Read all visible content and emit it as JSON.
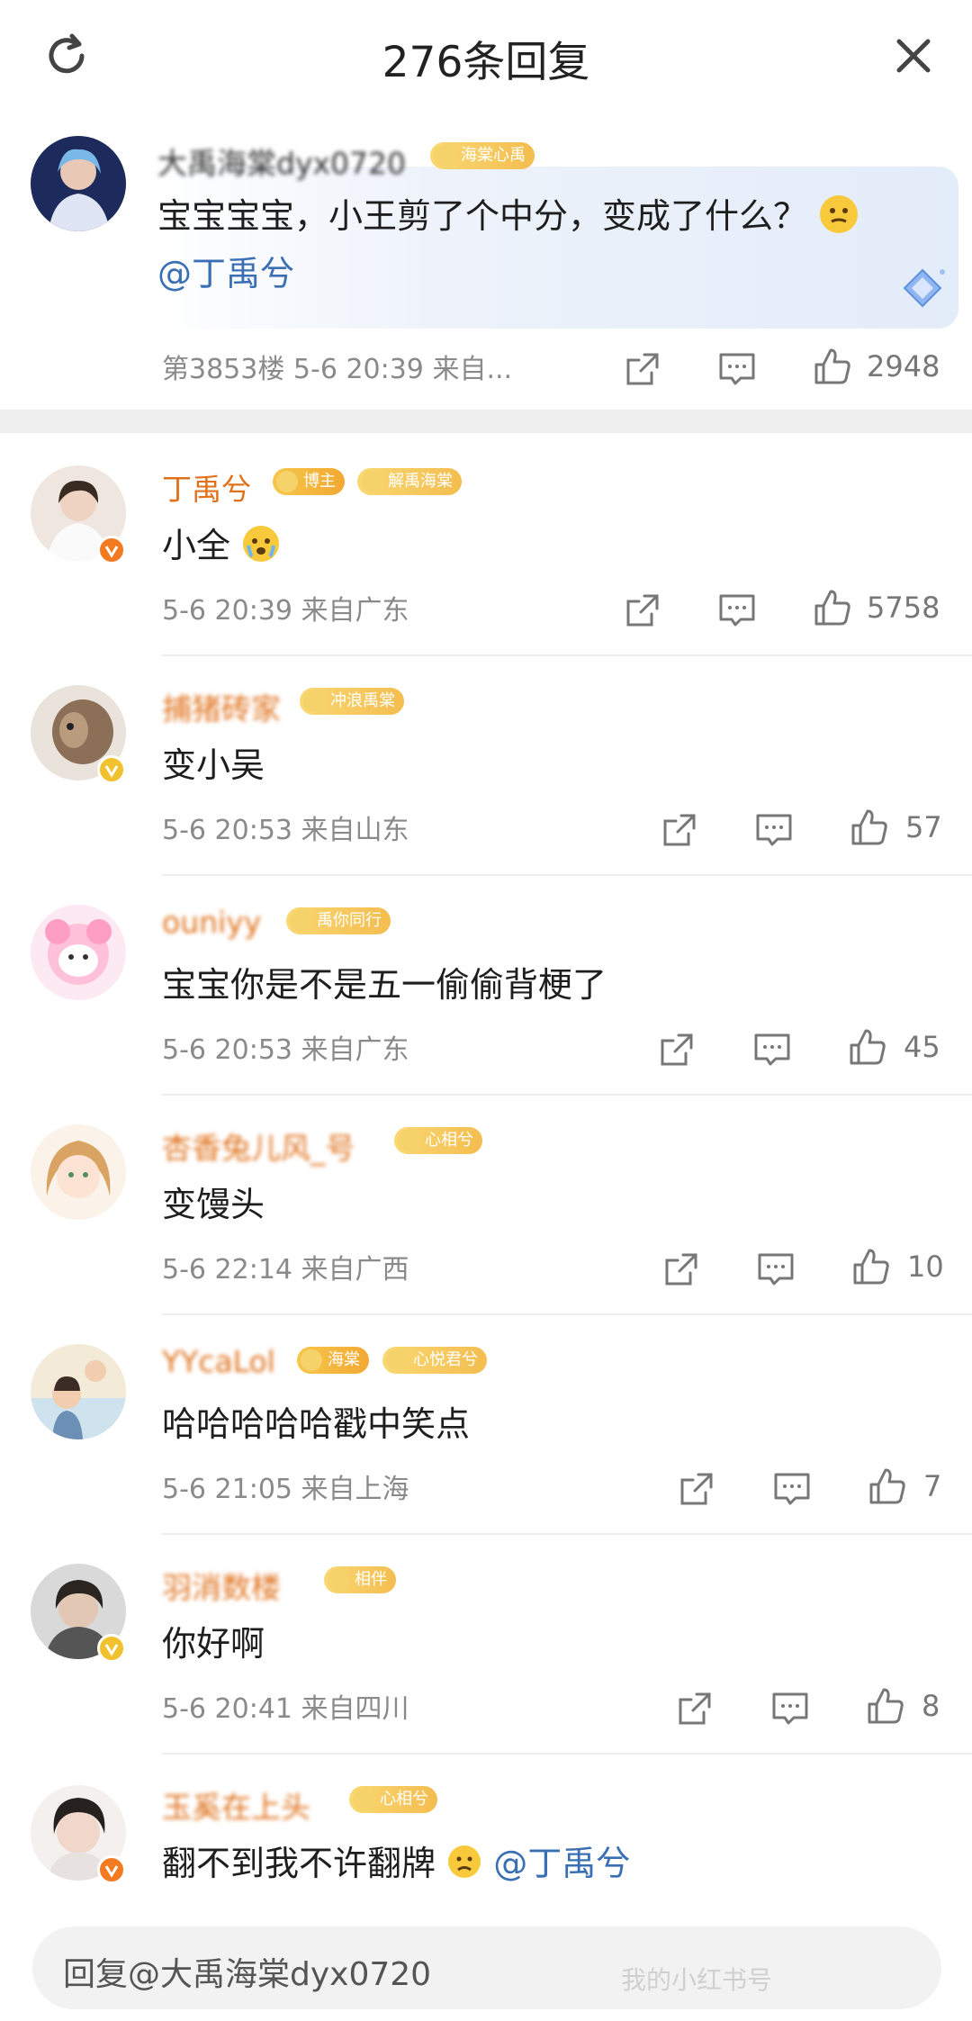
{
  "header": {
    "title": "276条回复"
  },
  "original": {
    "username": "大禹海棠dyx0720",
    "badge": "海棠心禹",
    "text": "宝宝宝宝，小王剪了个中分，变成了什么？",
    "mention": "@丁禹兮",
    "floor": "第3853楼",
    "time": "5-6 20:39",
    "source": "来自...",
    "likes": "2948"
  },
  "replies": [
    {
      "username": "丁禹兮",
      "badges": [
        "博主",
        "解禹海棠"
      ],
      "text": "小全",
      "time": "5-6 20:39",
      "location": "来自广东",
      "likes": "5758"
    },
    {
      "username": "捕猪砖家",
      "badges": [
        "冲浪禹棠"
      ],
      "text": "变小吴",
      "time": "5-6 20:53",
      "location": "来自山东",
      "likes": "57"
    },
    {
      "username": "ouniyy",
      "badges": [
        "禹你同行"
      ],
      "text": "宝宝你是不是五一偷偷背梗了",
      "time": "5-6 20:53",
      "location": "来自广东",
      "likes": "45"
    },
    {
      "username": "杏香兔儿风_号",
      "badges": [
        "心相兮"
      ],
      "text": "变馒头",
      "time": "5-6 22:14",
      "location": "来自广西",
      "likes": "10"
    },
    {
      "username": "YYcaLol",
      "badges": [
        "海棠",
        "心悦君兮"
      ],
      "text": "哈哈哈哈哈戳中笑点",
      "time": "5-6 21:05",
      "location": "来自上海",
      "likes": "7"
    },
    {
      "username": "羽消数楼",
      "badges": [
        "相伴"
      ],
      "text": "你好啊",
      "time": "5-6 20:41",
      "location": "来自四川",
      "likes": "8"
    },
    {
      "username": "玉奚在上头",
      "badges": [
        "心相兮"
      ],
      "text": "翻不到我不许翻牌",
      "mention": "@丁禹兮",
      "time": "",
      "location": "",
      "likes": ""
    }
  ],
  "reply_input": {
    "placeholder": "回复@大禹海棠dyx0720"
  },
  "watermark": "我的小红书号",
  "colors": {
    "username": "#e0721c",
    "mention": "#3a6fb3",
    "meta": "#8a8a8a",
    "badge_gold": "#f2a933",
    "verified_orange": "#f47a20",
    "verified_gold": "#f2c12e"
  },
  "icons": {
    "refresh": "refresh-icon",
    "close": "close-icon",
    "share": "share-icon",
    "comment": "comment-icon",
    "like": "thumbs-up-icon"
  }
}
